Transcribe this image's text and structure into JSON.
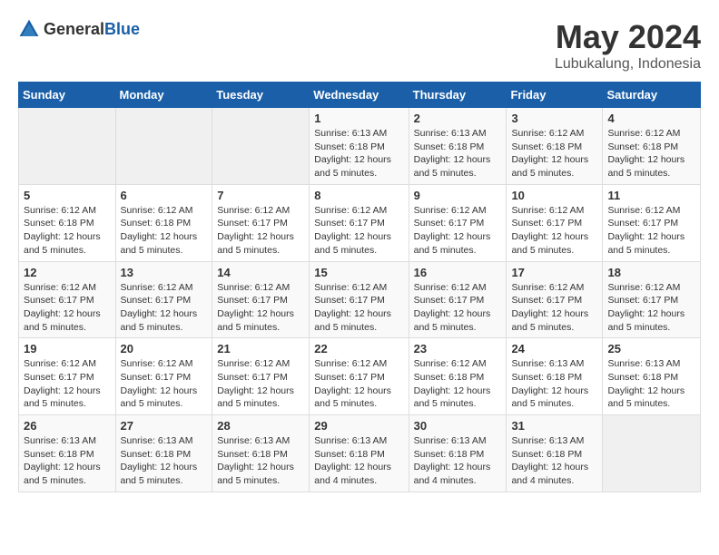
{
  "logo": {
    "general": "General",
    "blue": "Blue"
  },
  "title": "May 2024",
  "location": "Lubukalung, Indonesia",
  "headers": [
    "Sunday",
    "Monday",
    "Tuesday",
    "Wednesday",
    "Thursday",
    "Friday",
    "Saturday"
  ],
  "weeks": [
    [
      {
        "day": "",
        "info": ""
      },
      {
        "day": "",
        "info": ""
      },
      {
        "day": "",
        "info": ""
      },
      {
        "day": "1",
        "info": "Sunrise: 6:13 AM\nSunset: 6:18 PM\nDaylight: 12 hours\nand 5 minutes."
      },
      {
        "day": "2",
        "info": "Sunrise: 6:13 AM\nSunset: 6:18 PM\nDaylight: 12 hours\nand 5 minutes."
      },
      {
        "day": "3",
        "info": "Sunrise: 6:12 AM\nSunset: 6:18 PM\nDaylight: 12 hours\nand 5 minutes."
      },
      {
        "day": "4",
        "info": "Sunrise: 6:12 AM\nSunset: 6:18 PM\nDaylight: 12 hours\nand 5 minutes."
      }
    ],
    [
      {
        "day": "5",
        "info": "Sunrise: 6:12 AM\nSunset: 6:18 PM\nDaylight: 12 hours\nand 5 minutes."
      },
      {
        "day": "6",
        "info": "Sunrise: 6:12 AM\nSunset: 6:18 PM\nDaylight: 12 hours\nand 5 minutes."
      },
      {
        "day": "7",
        "info": "Sunrise: 6:12 AM\nSunset: 6:17 PM\nDaylight: 12 hours\nand 5 minutes."
      },
      {
        "day": "8",
        "info": "Sunrise: 6:12 AM\nSunset: 6:17 PM\nDaylight: 12 hours\nand 5 minutes."
      },
      {
        "day": "9",
        "info": "Sunrise: 6:12 AM\nSunset: 6:17 PM\nDaylight: 12 hours\nand 5 minutes."
      },
      {
        "day": "10",
        "info": "Sunrise: 6:12 AM\nSunset: 6:17 PM\nDaylight: 12 hours\nand 5 minutes."
      },
      {
        "day": "11",
        "info": "Sunrise: 6:12 AM\nSunset: 6:17 PM\nDaylight: 12 hours\nand 5 minutes."
      }
    ],
    [
      {
        "day": "12",
        "info": "Sunrise: 6:12 AM\nSunset: 6:17 PM\nDaylight: 12 hours\nand 5 minutes."
      },
      {
        "day": "13",
        "info": "Sunrise: 6:12 AM\nSunset: 6:17 PM\nDaylight: 12 hours\nand 5 minutes."
      },
      {
        "day": "14",
        "info": "Sunrise: 6:12 AM\nSunset: 6:17 PM\nDaylight: 12 hours\nand 5 minutes."
      },
      {
        "day": "15",
        "info": "Sunrise: 6:12 AM\nSunset: 6:17 PM\nDaylight: 12 hours\nand 5 minutes."
      },
      {
        "day": "16",
        "info": "Sunrise: 6:12 AM\nSunset: 6:17 PM\nDaylight: 12 hours\nand 5 minutes."
      },
      {
        "day": "17",
        "info": "Sunrise: 6:12 AM\nSunset: 6:17 PM\nDaylight: 12 hours\nand 5 minutes."
      },
      {
        "day": "18",
        "info": "Sunrise: 6:12 AM\nSunset: 6:17 PM\nDaylight: 12 hours\nand 5 minutes."
      }
    ],
    [
      {
        "day": "19",
        "info": "Sunrise: 6:12 AM\nSunset: 6:17 PM\nDaylight: 12 hours\nand 5 minutes."
      },
      {
        "day": "20",
        "info": "Sunrise: 6:12 AM\nSunset: 6:17 PM\nDaylight: 12 hours\nand 5 minutes."
      },
      {
        "day": "21",
        "info": "Sunrise: 6:12 AM\nSunset: 6:17 PM\nDaylight: 12 hours\nand 5 minutes."
      },
      {
        "day": "22",
        "info": "Sunrise: 6:12 AM\nSunset: 6:17 PM\nDaylight: 12 hours\nand 5 minutes."
      },
      {
        "day": "23",
        "info": "Sunrise: 6:12 AM\nSunset: 6:18 PM\nDaylight: 12 hours\nand 5 minutes."
      },
      {
        "day": "24",
        "info": "Sunrise: 6:13 AM\nSunset: 6:18 PM\nDaylight: 12 hours\nand 5 minutes."
      },
      {
        "day": "25",
        "info": "Sunrise: 6:13 AM\nSunset: 6:18 PM\nDaylight: 12 hours\nand 5 minutes."
      }
    ],
    [
      {
        "day": "26",
        "info": "Sunrise: 6:13 AM\nSunset: 6:18 PM\nDaylight: 12 hours\nand 5 minutes."
      },
      {
        "day": "27",
        "info": "Sunrise: 6:13 AM\nSunset: 6:18 PM\nDaylight: 12 hours\nand 5 minutes."
      },
      {
        "day": "28",
        "info": "Sunrise: 6:13 AM\nSunset: 6:18 PM\nDaylight: 12 hours\nand 5 minutes."
      },
      {
        "day": "29",
        "info": "Sunrise: 6:13 AM\nSunset: 6:18 PM\nDaylight: 12 hours\nand 4 minutes."
      },
      {
        "day": "30",
        "info": "Sunrise: 6:13 AM\nSunset: 6:18 PM\nDaylight: 12 hours\nand 4 minutes."
      },
      {
        "day": "31",
        "info": "Sunrise: 6:13 AM\nSunset: 6:18 PM\nDaylight: 12 hours\nand 4 minutes."
      },
      {
        "day": "",
        "info": ""
      }
    ]
  ]
}
